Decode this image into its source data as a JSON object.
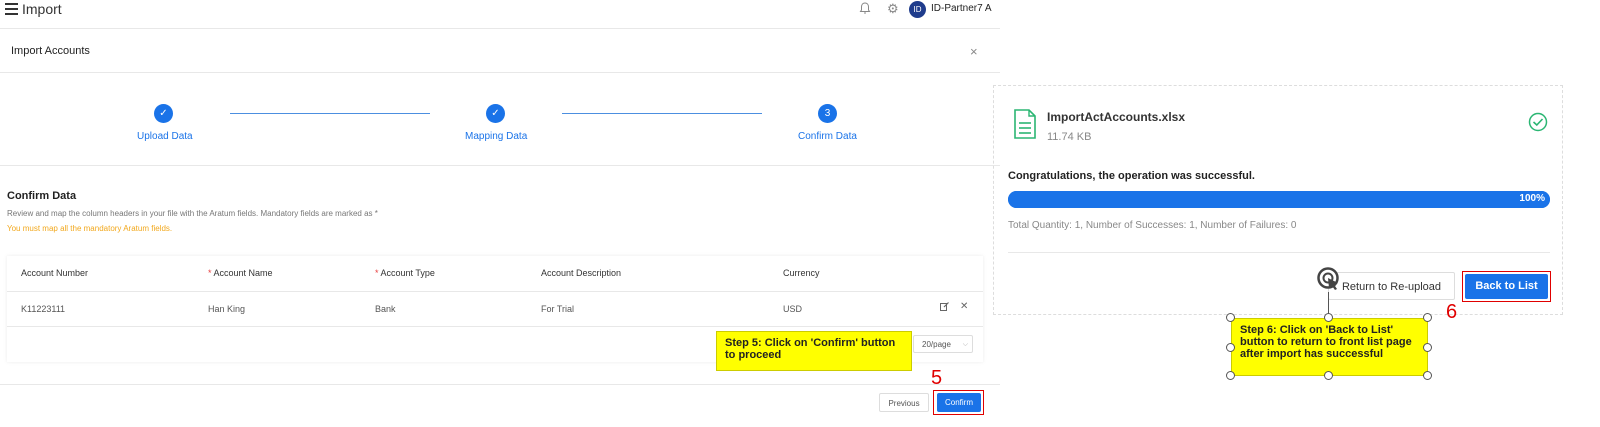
{
  "header": {
    "app_title": "Import",
    "user_name": "ID-Partner7 A",
    "avatar_text": "ID"
  },
  "modal": {
    "title": "Import Accounts",
    "close_glyph": "×"
  },
  "steps": [
    {
      "label": "Upload Data",
      "state": "done",
      "glyph": "✓"
    },
    {
      "label": "Mapping Data",
      "state": "done",
      "glyph": "✓"
    },
    {
      "label": "Confirm Data",
      "state": "current",
      "glyph": "3"
    }
  ],
  "confirm": {
    "title": "Confirm Data",
    "description": "Review and map the column headers in your file with the Aratum fields. Mandatory fields are marked as *",
    "warning": "You must map all the mandatory Aratum fields."
  },
  "table": {
    "columns": [
      {
        "label": "Account Number",
        "required": false
      },
      {
        "label": "Account Name",
        "required": true
      },
      {
        "label": "Account Type",
        "required": true
      },
      {
        "label": "Account Description",
        "required": false
      },
      {
        "label": "Currency",
        "required": false
      }
    ],
    "required_mark": "*",
    "rows": [
      [
        "K11223111",
        "Han King",
        "Bank",
        "For Trial",
        "USD"
      ]
    ],
    "row_actions": {
      "edit_icon": "edit-icon",
      "delete_icon": "close-icon"
    },
    "page_size": "20/page"
  },
  "buttons": {
    "previous": "Previous",
    "confirm": "Confirm",
    "return_reupload": "Return to Re-upload",
    "back_to_list": "Back to List"
  },
  "annotations": {
    "step5": {
      "number": "5",
      "text": "Step 5: Click on 'Confirm' button to proceed"
    },
    "step6": {
      "number": "6",
      "text": "Step 6: Click on 'Back to List' button to return to front list page after import has successful"
    }
  },
  "result": {
    "file_name": "ImportActAccounts.xlsx",
    "file_size": "11.74 KB",
    "message": "Congratulations, the operation was successful.",
    "progress_percent": 100,
    "progress_label": "100%",
    "totals": "Total Quantity: 1, Number of Successes: 1, Number of Failures: 0"
  },
  "colors": {
    "primary": "#1a73e8",
    "success": "#2bb673",
    "highlight": "#ffff00",
    "annotation_red": "#e00000"
  }
}
